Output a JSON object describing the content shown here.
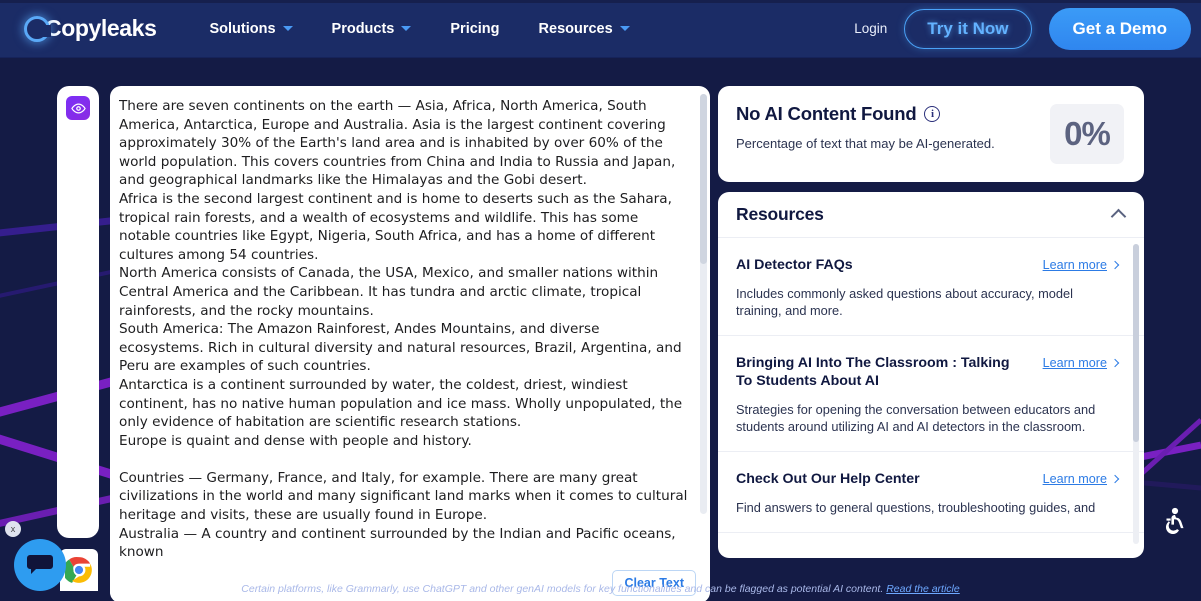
{
  "header": {
    "logo_text": "Copyleaks",
    "nav": [
      {
        "label": "Solutions",
        "has_caret": true
      },
      {
        "label": "Products",
        "has_caret": true
      },
      {
        "label": "Pricing",
        "has_caret": false
      },
      {
        "label": "Resources",
        "has_caret": true
      }
    ],
    "login_label": "Login",
    "try_label": "Try it Now",
    "demo_label": "Get a Demo",
    "accent_blue": "#3b9bf7",
    "header_bg": "#1b2c66"
  },
  "editor": {
    "eye_icon": "eye-icon",
    "clear_label": "Clear Text",
    "paragraphs": [
      "There are seven continents on the earth  — Asia, Africa, North America, South America, Antarctica, Europe and Australia. Asia is the largest continent covering approximately 30% of the Earth's land  area and is inhabited by over 60% of the world population. This covers countries from China and India to Russia and Japan, and geographical landmarks  like the Himalayas and the Gobi desert.",
      "Africa is the second largest continent and is home  to deserts such as the Sahara, tropical rain forests, and a wealth of ecosystems and wildlife. This has some  notable countries like Egypt, Nigeria, South Africa, and has a home of different cultures among 54 countries.",
      "North America consists of Canada, the USA, Mexico,  and smaller nations within Central America and the Caribbean. It has tundra and arctic climate, tropical rainforests, and the rocky  mountains.",
      "South America: The Amazon Rainforest, Andes Mountains, and diverse  ecosystems. Rich in cultural diversity and natural resources, Brazil, Argentina,  and Peru are examples of such countries.",
      "Antarctica is a continent surrounded by water, the coldest, driest, windiest continent, has no native human population and ice mass. Wholly  unpopulated, the only evidence of habitation are scientific research stations.",
      "Europe is quaint and dense with  people and history.",
      "",
      "Countries — Germany, France,  and Italy, for example. There are many great civilizations in the world and many significant land marks when it comes to cultural heritage and visits, these are  usually found in Europe.",
      "Australia — A country and continent surrounded by the Indian and Pacific oceans,  known"
    ]
  },
  "result": {
    "title": "No AI Content Found",
    "info_icon": "info-icon",
    "subtitle": "Percentage of text that may be AI-generated.",
    "percentage": "0%"
  },
  "resources": {
    "title": "Resources",
    "collapse_icon": "chevron-up-icon",
    "learn_more_label": "Learn more",
    "items": [
      {
        "title": "AI Detector FAQs",
        "description": "Includes commonly asked questions about accuracy, model training, and more."
      },
      {
        "title": "Bringing AI Into The Classroom : Talking To Students About AI",
        "description": "Strategies for opening the conversation between educators and students around utilizing AI and AI detectors in the classroom."
      },
      {
        "title": "Check Out Our Help Center",
        "description": "Find answers to general questions, troubleshooting guides, and"
      }
    ]
  },
  "footer": {
    "note": "Certain platforms, like Grammarly, use ChatGPT and other genAI models for key functionalities and can be flagged as potential AI content.",
    "link_label": "Read the article"
  },
  "widgets": {
    "chat_icon": "chat-bubble-icon",
    "chat_close_label": "x",
    "browser_icon": "chrome-icon",
    "accessibility_icon": "accessibility-icon"
  }
}
